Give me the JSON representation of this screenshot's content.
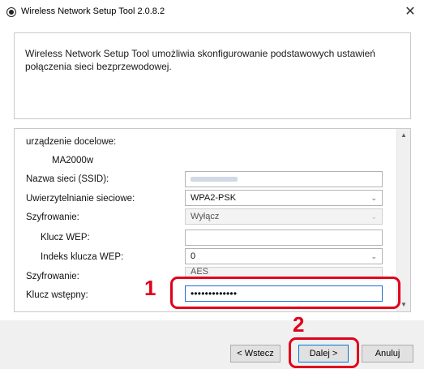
{
  "window": {
    "title": "Wireless Network Setup Tool 2.0.8.2",
    "close_glyph": "✕"
  },
  "info": {
    "text": "Wireless Network Setup Tool umożliwia skonfigurowanie podstawowych ustawień połączenia sieci bezprzewodowej."
  },
  "form": {
    "device_label": "urządzenie docelowe:",
    "device_value": "MA2000w",
    "ssid_label": "Nazwa sieci (SSID):",
    "ssid_value_blurred": true,
    "auth_label": "Uwierzytelnianie sieciowe:",
    "auth_value": "WPA2-PSK",
    "encryption1_label": "Szyfrowanie:",
    "encryption1_value": "Wyłącz",
    "wep_key_label": "Klucz WEP:",
    "wep_key_value": "",
    "wep_index_label": "Indeks klucza WEP:",
    "wep_index_value": "0",
    "encryption2_label": "Szyfrowanie:",
    "encryption2_value": "AES",
    "psk_label": "Klucz wstępny:",
    "psk_value": "•••••••••••••"
  },
  "buttons": {
    "back": "< Wstecz",
    "next": "Dalej >",
    "cancel": "Anuluj"
  },
  "annotations": {
    "step1": "1",
    "step2": "2"
  },
  "icons": {
    "title": "app-radio-icon",
    "close": "close-icon",
    "dropdown": "chevron-down-icon",
    "scroll_up": "scroll-up-arrow-icon",
    "scroll_down": "scroll-down-arrow-icon"
  },
  "colors": {
    "highlight": "#e0001b",
    "focus_border": "#1f6fd1",
    "default_button_border": "#0078d7"
  }
}
